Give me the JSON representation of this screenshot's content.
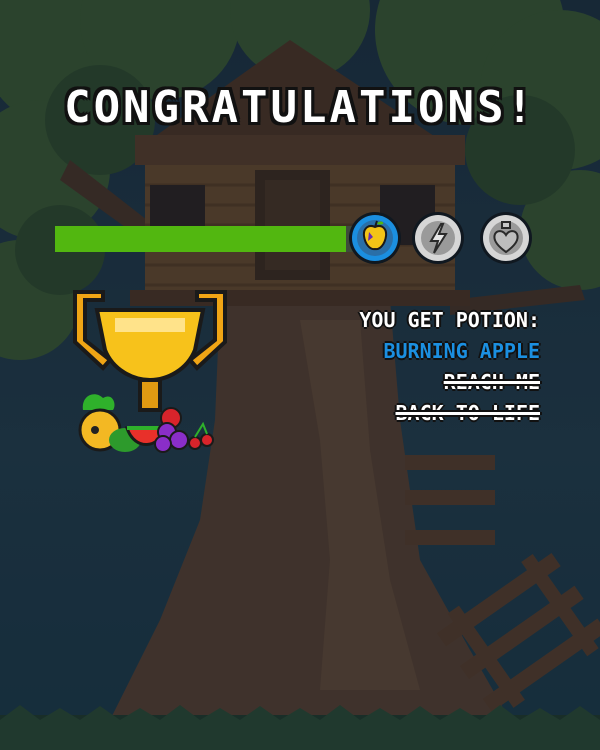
{
  "title": "CONGRATULATIONS!",
  "progress": {
    "fraction": 0.97,
    "fill_color": "#52b710"
  },
  "badges": [
    {
      "name": "golden-apple-badge",
      "icon": "apple-icon",
      "state": "active",
      "ring_color": "#1b8fe0"
    },
    {
      "name": "lightning-badge",
      "icon": "lightning-icon",
      "state": "locked"
    },
    {
      "name": "heart-potion-badge",
      "icon": "heart-potion-icon",
      "state": "locked"
    }
  ],
  "rewards": {
    "heading": "YOU GET POTION:",
    "items": [
      {
        "label": "BURNING APPLE",
        "status": "highlighted"
      },
      {
        "label": "REACH ME",
        "status": "struck"
      },
      {
        "label": "BACK TO LIFE",
        "status": "struck"
      }
    ]
  }
}
